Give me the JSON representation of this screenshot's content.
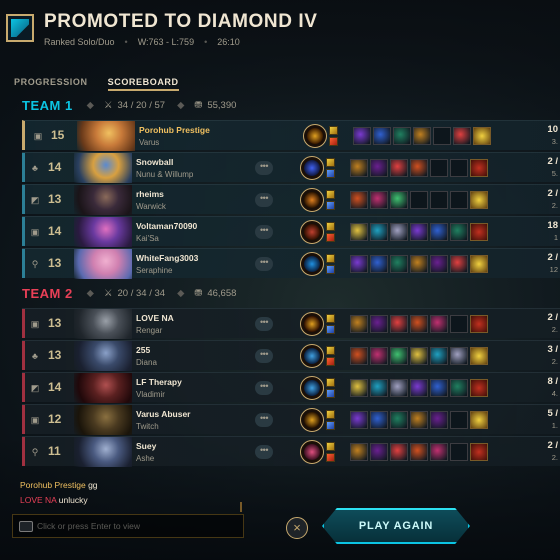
{
  "header": {
    "title": "PROMOTED TO DIAMOND IV",
    "queue": "Ranked Solo/Duo",
    "record": "W:763 - L:759",
    "duration": "26:10"
  },
  "tabs": [
    {
      "label": "PROGRESSION"
    },
    {
      "label": "SCOREBOARD"
    }
  ],
  "teams": [
    {
      "name": "TEAM 1",
      "kda": "34 / 20 / 57",
      "gold": "55,390",
      "color": "#0bc4e3",
      "players": [
        {
          "level": "15",
          "name": "Porohub Prestige",
          "champion": "Varus",
          "kda": "10",
          "sub": "3.",
          "role": "bot"
        },
        {
          "level": "14",
          "name": "Snowball",
          "champion": "Nunu & Willump",
          "kda": "2 /",
          "sub": "5.",
          "role": "jungle"
        },
        {
          "level": "13",
          "name": "rheims",
          "champion": "Warwick",
          "kda": "2 /",
          "sub": "2.",
          "role": "mid"
        },
        {
          "level": "14",
          "name": "Voltaman70090",
          "champion": "Kai'Sa",
          "kda": "18",
          "sub": "1",
          "role": "top"
        },
        {
          "level": "13",
          "name": "WhiteFang3003",
          "champion": "Seraphine",
          "kda": "2 /",
          "sub": "12",
          "role": "support"
        }
      ]
    },
    {
      "name": "TEAM 2",
      "kda": "20 / 34 / 34",
      "gold": "46,658",
      "color": "#e84057",
      "players": [
        {
          "level": "13",
          "name": "LOVE NA",
          "champion": "Rengar",
          "kda": "2 /",
          "sub": "2.",
          "role": "top"
        },
        {
          "level": "13",
          "name": "255",
          "champion": "Diana",
          "kda": "3 /",
          "sub": "2.",
          "role": "jungle"
        },
        {
          "level": "14",
          "name": "LF Therapy",
          "champion": "Vladimir",
          "kda": "8 /",
          "sub": "4.",
          "role": "mid"
        },
        {
          "level": "12",
          "name": "Varus Abuser",
          "champion": "Twitch",
          "kda": "5 /",
          "sub": "1.",
          "role": "bot"
        },
        {
          "level": "11",
          "name": "Suey",
          "champion": "Ashe",
          "kda": "2 /",
          "sub": "2.",
          "role": "support"
        }
      ]
    }
  ],
  "chat": [
    {
      "sender": "Porohub Prestige",
      "text": "gg",
      "sender_color": "#f0c060"
    },
    {
      "sender": "LOVE NA",
      "text": "unlucky",
      "sender_color": "#e84057"
    }
  ],
  "chat_input": {
    "placeholder": "Click or press Enter to view"
  },
  "actions": {
    "close": "×",
    "play_again": "PLAY AGAIN"
  },
  "icons": {
    "more": "•••",
    "gold": "coin-icon",
    "kda": "swords-icon"
  }
}
